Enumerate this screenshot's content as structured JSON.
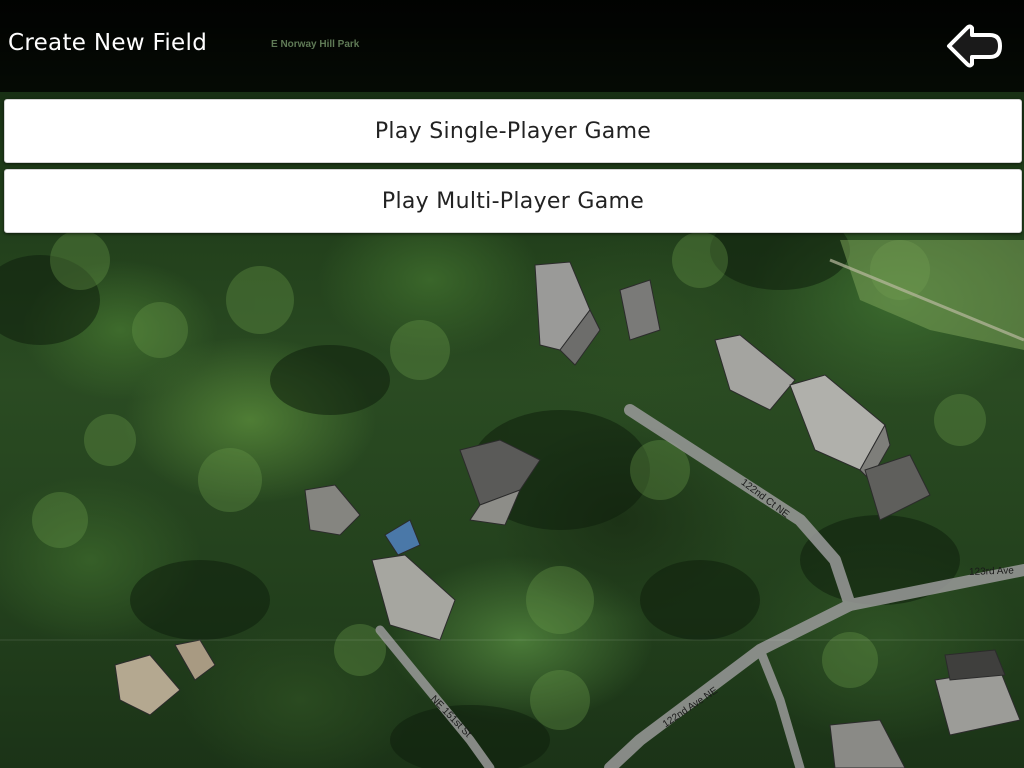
{
  "header": {
    "title": "Create New Field",
    "map_label": "E Norway Hill Park",
    "back_icon": "back-arrow-icon"
  },
  "menu": {
    "single_player_label": "Play Single-Player Game",
    "multi_player_label": "Play Multi-Player Game"
  },
  "map": {
    "type": "satellite",
    "roads": {
      "road_122nd_ct": "122nd Ct NE",
      "road_123rd_ave": "123rd Ave",
      "road_122nd_ave": "122nd Ave NE",
      "road_151st_st": "NE 151st St"
    }
  },
  "colors": {
    "topbar": "#000000",
    "button_bg": "#ffffff",
    "road": "#9a9a9a"
  }
}
